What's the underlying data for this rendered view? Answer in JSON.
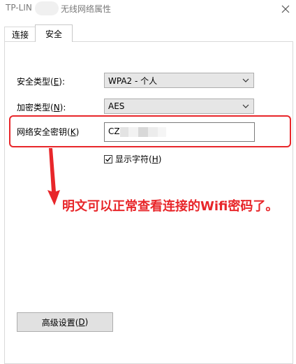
{
  "window": {
    "title_prefix": "TP-LIN",
    "title_suffix": "无线网络属性",
    "close_icon": "close-icon"
  },
  "tabs": [
    {
      "label": "连接",
      "active": false
    },
    {
      "label": "安全",
      "active": true
    }
  ],
  "security": {
    "type_label_main": "安全类型(",
    "type_label_key": "E",
    "type_label_end": "):",
    "type_value": "WPA2 - 个人",
    "encryption_label_main": "加密类型(",
    "encryption_label_key": "N",
    "encryption_label_end": "):",
    "encryption_value": "AES",
    "key_label_main": "网络安全密钥(",
    "key_label_key": "K",
    "key_label_end": ")",
    "key_value_visible": "CZ",
    "show_chars_main": "显示字符(",
    "show_chars_key": "H",
    "show_chars_end": ")",
    "show_chars_checked": true
  },
  "annotation": {
    "text": "明文可以正常查看连接的Wifi密码了。",
    "color": "#e8262a"
  },
  "advanced": {
    "label_main": "高级设置(",
    "label_key": "D",
    "label_end": ")"
  }
}
